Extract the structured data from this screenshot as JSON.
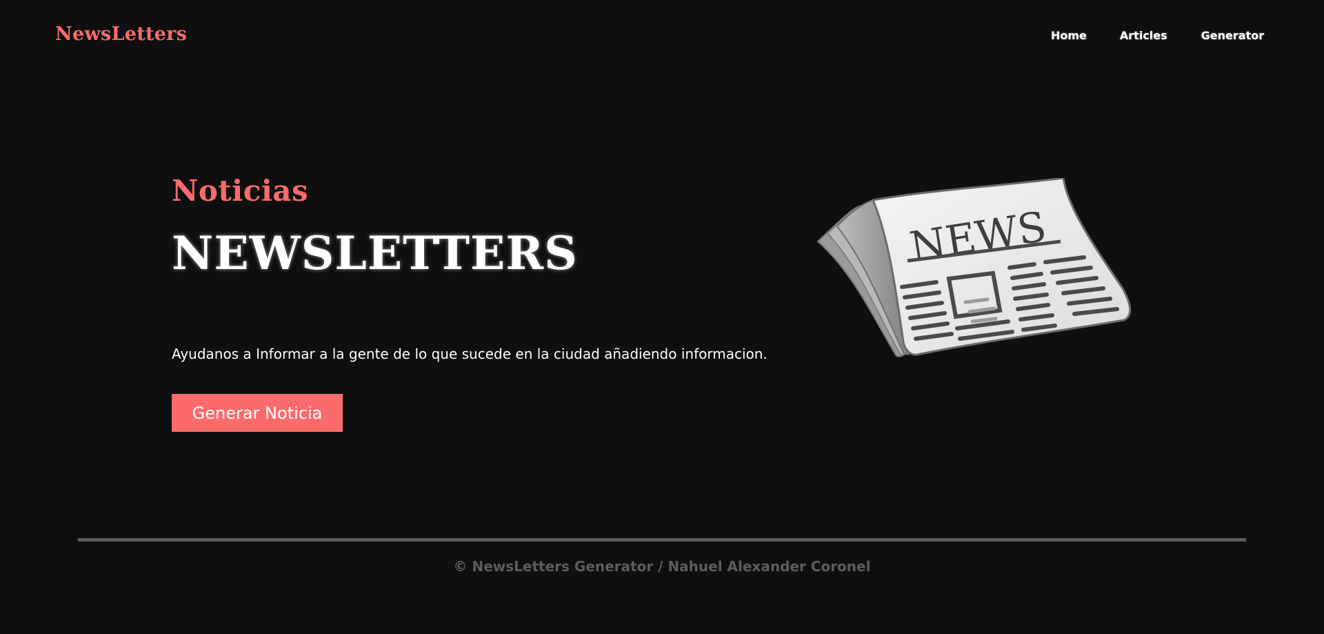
{
  "colors": {
    "background": "#0f0f0f",
    "accent": "#fb6b6b",
    "text": "#ffffff",
    "muted": "#5d5d5d"
  },
  "navbar": {
    "brand": "NewsLetters",
    "links": [
      {
        "label": "Home"
      },
      {
        "label": "Articles"
      },
      {
        "label": "Generator"
      }
    ]
  },
  "hero": {
    "eyebrow": "Noticias",
    "title": "NEWSLETTERS",
    "description": "Ayudanos a Informar a la gente de lo que sucede en la ciudad añadiendo informacion.",
    "cta_label": "Generar Noticia",
    "illustration": {
      "icon": "newspaper-icon",
      "text": "NEWS"
    }
  },
  "footer": {
    "text": "© NewsLetters Generator / Nahuel Alexander Coronel"
  }
}
